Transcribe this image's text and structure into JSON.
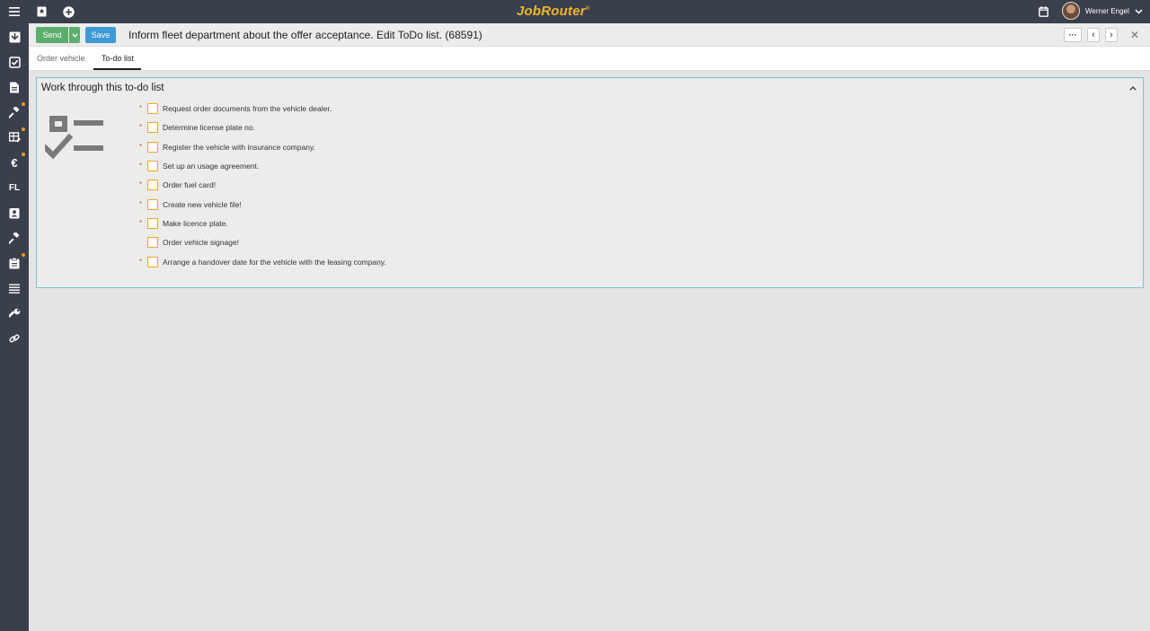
{
  "topbar": {
    "logo": "JobRouter",
    "logo_mark": "®",
    "user_name": "Werner Engel",
    "icons": [
      "menu-icon",
      "bookmark-icon",
      "add-icon",
      "calendar-icon",
      "chevron-down-icon"
    ]
  },
  "sidebar": {
    "items": [
      {
        "name": "inbox-icon",
        "text": ""
      },
      {
        "name": "checked-box-icon",
        "text": ""
      },
      {
        "name": "document-icon",
        "text": ""
      },
      {
        "name": "gavel-icon",
        "text": "",
        "dot": true
      },
      {
        "name": "table-edit-icon",
        "text": "",
        "dot": true
      },
      {
        "name": "euro-icon",
        "text": "€",
        "dot": true
      },
      {
        "name": "fl-icon",
        "text": "FL",
        "dot": false
      },
      {
        "name": "contact-card-icon",
        "text": ""
      },
      {
        "name": "hammer-icon",
        "text": ""
      },
      {
        "name": "clipboard-icon",
        "text": "",
        "dot": true
      },
      {
        "name": "list-icon",
        "text": ""
      },
      {
        "name": "wrench-icon",
        "text": ""
      },
      {
        "name": "link-icon",
        "text": ""
      }
    ]
  },
  "actionbar": {
    "send_label": "Send",
    "save_label": "Save",
    "title": "Inform fleet department about the offer acceptance. Edit ToDo list. (68591)",
    "more_label": "···",
    "prev_label": "‹",
    "next_label": "›",
    "close_label": "✕"
  },
  "tabs": [
    {
      "label": "Order vehicle",
      "active": false
    },
    {
      "label": "To-do list",
      "active": true
    }
  ],
  "panel": {
    "title": "Work through this to-do list",
    "collapse_icon": "chevron-up-icon",
    "todos": [
      {
        "label": "Request order documents from the vehicle dealer.",
        "required": true,
        "checked": false
      },
      {
        "label": "Determine license plate no.",
        "required": true,
        "checked": false
      },
      {
        "label": "Register the vehicle with insurance company.",
        "required": true,
        "checked": false
      },
      {
        "label": "Set up an usage agreement.",
        "required": true,
        "checked": false
      },
      {
        "label": "Order fuel card!",
        "required": true,
        "checked": false
      },
      {
        "label": "Create new vehicle file!",
        "required": true,
        "checked": false
      },
      {
        "label": "Make licence plate.",
        "required": true,
        "checked": false
      },
      {
        "label": "Order vehicle signage!",
        "required": false,
        "checked": false
      },
      {
        "label": "Arrange a handover date for the vehicle with the leasing company.",
        "required": true,
        "checked": false
      }
    ],
    "required_marker": "*"
  },
  "colors": {
    "chrome": "#3a3f4c",
    "logo": "#f3b42c",
    "send": "#5cae6c",
    "save": "#3e9ad6",
    "panel_border": "#7dc3cf",
    "checkbox_border": "#f0a417",
    "required": "#e24b3b",
    "notification_dot": "#f39a1e"
  }
}
